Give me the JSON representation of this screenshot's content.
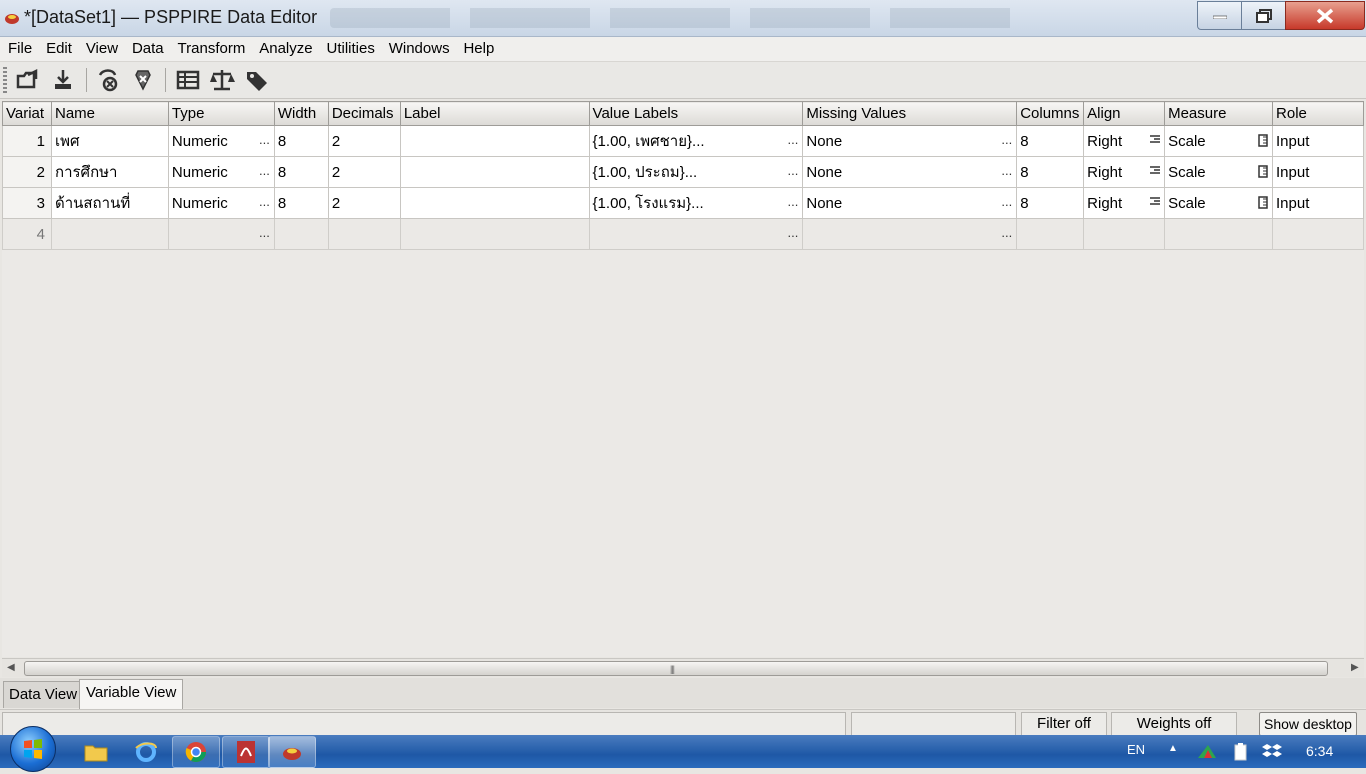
{
  "window": {
    "title": "*[DataSet1] — PSPPIRE Data Editor"
  },
  "menu": [
    {
      "label": "File"
    },
    {
      "label": "Edit"
    },
    {
      "label": "View"
    },
    {
      "label": "Data"
    },
    {
      "label": "Transform"
    },
    {
      "label": "Analyze"
    },
    {
      "label": "Utilities"
    },
    {
      "label": "Windows"
    },
    {
      "label": "Help"
    }
  ],
  "toolbar": [
    {
      "icon": "open-file-icon"
    },
    {
      "icon": "save-icon"
    },
    {
      "icon": "goto-case-icon"
    },
    {
      "icon": "find-icon"
    },
    {
      "icon": "split-file-icon"
    },
    {
      "icon": "weight-cases-icon"
    },
    {
      "icon": "value-labels-icon"
    }
  ],
  "grid": {
    "columns": [
      "Variat",
      "Name",
      "Type",
      "Width",
      "Decimals",
      "Label",
      "Value Labels",
      "Missing Values",
      "Columns",
      "Align",
      "Measure",
      "Role"
    ],
    "rows": [
      {
        "num": "1",
        "name": "เพศ",
        "type": "Numeric",
        "width": "8",
        "decimals": "2",
        "label": "",
        "value_labels": "{1.00, เพศชาย}...",
        "missing": "None",
        "columns": "8",
        "align": "Right",
        "measure": "Scale",
        "role": "Input"
      },
      {
        "num": "2",
        "name": "การศึกษา",
        "type": "Numeric",
        "width": "8",
        "decimals": "2",
        "label": "",
        "value_labels": "{1.00, ประถม}...",
        "missing": "None",
        "columns": "8",
        "align": "Right",
        "measure": "Scale",
        "role": "Input"
      },
      {
        "num": "3",
        "name": "ด้านสถานที่",
        "type": "Numeric",
        "width": "8",
        "decimals": "2",
        "label": "",
        "value_labels": "{1.00, โรงแรม}...",
        "missing": "None",
        "columns": "8",
        "align": "Right",
        "measure": "Scale",
        "role": "Input"
      }
    ],
    "empty_row_num": "4",
    "ellipsis": "..."
  },
  "tabs": {
    "data_view": "Data View",
    "variable_view": "Variable View"
  },
  "status": {
    "filter": "Filter off",
    "weights": "Weights off",
    "show_desktop": "Show desktop"
  },
  "taskbar": {
    "lang": "EN",
    "time": "6:34"
  },
  "colors": {
    "taskbar": "#1e58a6",
    "close_button": "#c7392a"
  }
}
